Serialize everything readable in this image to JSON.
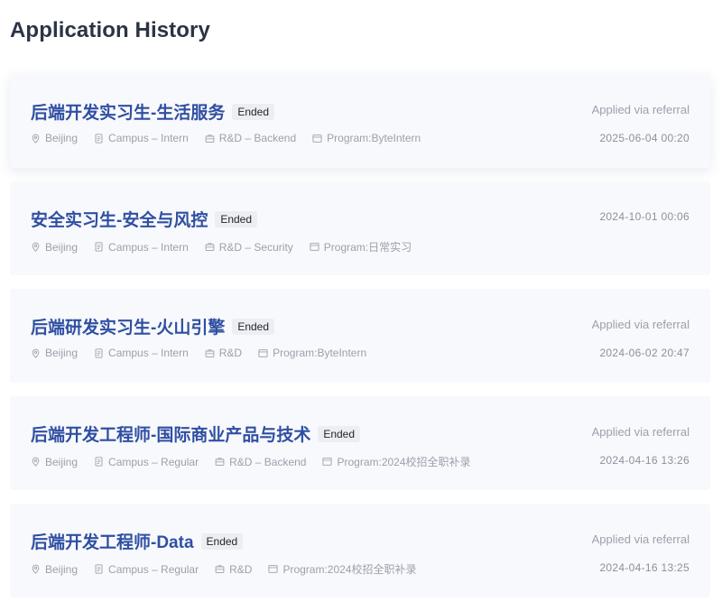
{
  "page": {
    "title": "Application History"
  },
  "applications": [
    {
      "title": "后端开发实习生-生活服务",
      "status": "Ended",
      "location": "Beijing",
      "type": "Campus – Intern",
      "category": "R&D – Backend",
      "program": "Program:ByteIntern",
      "source": "Applied via referral",
      "date": "2025-06-04 00:20"
    },
    {
      "title": "安全实习生-安全与风控",
      "status": "Ended",
      "location": "Beijing",
      "type": "Campus – Intern",
      "category": "R&D – Security",
      "program": "Program:日常实习",
      "date": "2024-10-01 00:06"
    },
    {
      "title": "后端研发实习生-火山引擎",
      "status": "Ended",
      "location": "Beijing",
      "type": "Campus – Intern",
      "category": "R&D",
      "program": "Program:ByteIntern",
      "source": "Applied via referral",
      "date": "2024-06-02 20:47"
    },
    {
      "title": "后端开发工程师-国际商业产品与技术",
      "status": "Ended",
      "location": "Beijing",
      "type": "Campus – Regular",
      "category": "R&D – Backend",
      "program": "Program:2024校招全职补录",
      "source": "Applied via referral",
      "date": "2024-04-16 13:26"
    },
    {
      "title": "后端开发工程师-Data",
      "status": "Ended",
      "location": "Beijing",
      "type": "Campus – Regular",
      "category": "R&D",
      "program": "Program:2024校招全职补录",
      "source": "Applied via referral",
      "date": "2024-04-16 13:25"
    }
  ]
}
